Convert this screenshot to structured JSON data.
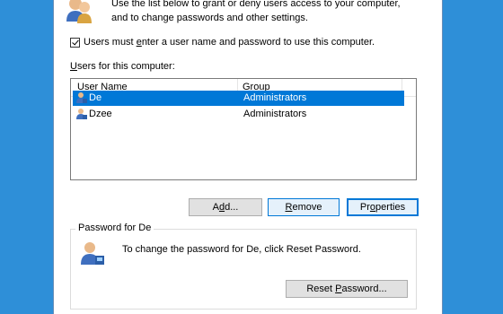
{
  "intro": {
    "line1": "Use the list below to grant or deny users access to your computer,",
    "line2": "and to change passwords and other settings."
  },
  "require_login": {
    "checked": true,
    "label_pre": "Users must ",
    "label_accel": "e",
    "label_post": "nter a user name and password to use this computer."
  },
  "users_label": {
    "accel": "U",
    "rest": "sers for this computer:"
  },
  "columns": {
    "name": "User Name",
    "group": "Group"
  },
  "users": [
    {
      "name": "De",
      "group": "Administrators",
      "selected": true
    },
    {
      "name": "Dzee",
      "group": "Administrators",
      "selected": false
    }
  ],
  "buttons": {
    "add": {
      "pre": "A",
      "accel": "d",
      "post": "d..."
    },
    "remove": {
      "pre": "",
      "accel": "R",
      "post": "emove"
    },
    "properties": {
      "pre": "Pr",
      "accel": "o",
      "post": "perties"
    },
    "reset_password": {
      "pre": "Reset ",
      "accel": "P",
      "post": "assword..."
    }
  },
  "password_group": {
    "title": "Password for De",
    "text": "To change the password for De, click Reset Password."
  },
  "colors": {
    "selection": "#0078d7",
    "desktop": "#2e8fd8"
  }
}
